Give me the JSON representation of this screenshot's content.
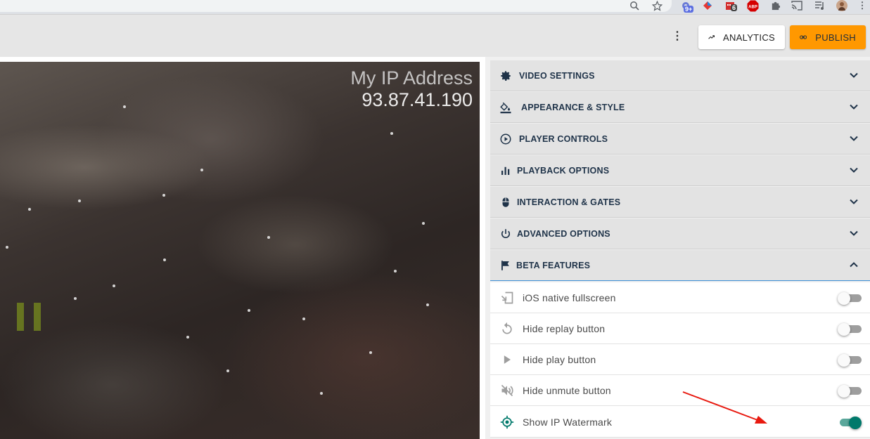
{
  "browser": {
    "extensions": [
      {
        "icon": "zoom-icon"
      },
      {
        "icon": "star-icon"
      },
      {
        "icon": "extension-gear-icon",
        "badge": "9+"
      },
      {
        "icon": "extension-diamond-icon"
      },
      {
        "icon": "extension-calendar-icon",
        "badge": "6"
      },
      {
        "icon": "adblock-icon",
        "label": "ABP"
      },
      {
        "icon": "puzzle-icon"
      },
      {
        "icon": "cast-icon"
      },
      {
        "icon": "media-icon"
      },
      {
        "icon": "profile-avatar"
      },
      {
        "icon": "menu-icon"
      }
    ]
  },
  "header": {
    "analytics_label": "ANALYTICS",
    "publish_label": "PUBLISH",
    "accent_color": "#ff9800"
  },
  "video": {
    "watermark_title": "My IP Address",
    "watermark_ip": "93.87.41.190",
    "state": "paused"
  },
  "panel": {
    "sections": [
      {
        "label": "VIDEO SETTINGS",
        "icon": "gear-icon",
        "expanded": false
      },
      {
        "label": "APPEARANCE & STYLE",
        "icon": "paint-bucket-icon",
        "expanded": false
      },
      {
        "label": "PLAYER CONTROLS",
        "icon": "play-circle-icon",
        "expanded": false
      },
      {
        "label": "PLAYBACK OPTIONS",
        "icon": "bar-chart-icon",
        "expanded": false
      },
      {
        "label": "INTERACTION & GATES",
        "icon": "mouse-icon",
        "expanded": false
      },
      {
        "label": "ADVANCED OPTIONS",
        "icon": "power-icon",
        "expanded": false
      },
      {
        "label": "BETA FEATURES",
        "icon": "flag-icon",
        "expanded": true
      }
    ],
    "beta_features": [
      {
        "label": "iOS native fullscreen",
        "icon": "fullscreen-exit-icon",
        "enabled": false
      },
      {
        "label": "Hide replay button",
        "icon": "replay-icon",
        "enabled": false
      },
      {
        "label": "Hide play button",
        "icon": "play-icon",
        "enabled": false
      },
      {
        "label": "Hide unmute button",
        "icon": "volume-off-icon",
        "enabled": false
      },
      {
        "label": "Show IP Watermark",
        "icon": "crosshair-icon",
        "enabled": true
      }
    ],
    "toggle_on_color": "#00796b"
  }
}
